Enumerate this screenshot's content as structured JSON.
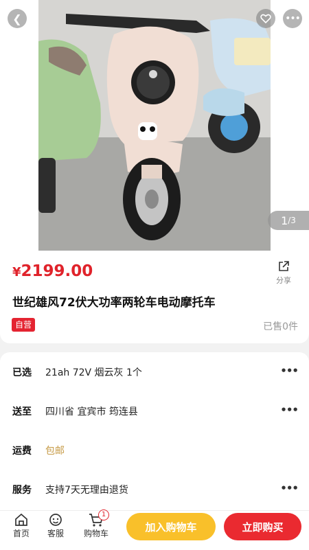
{
  "gallery": {
    "current": "1",
    "total": "/3"
  },
  "product": {
    "currency": "¥",
    "price": "2199.00",
    "title": "世纪雄风72伏大功率两轮车电动摩托车",
    "badge": "自营",
    "sold": "已售0件",
    "share_label": "分享"
  },
  "options": [
    {
      "label": "已选",
      "value": "21ah 72V 烟云灰 1个"
    },
    {
      "label": "送至",
      "value": "四川省 宜宾市 筠连县"
    },
    {
      "label": "运费",
      "value": "包邮"
    },
    {
      "label": "服务",
      "value": "支持7天无理由退货"
    }
  ],
  "bottom_bar": {
    "home": "首页",
    "service": "客服",
    "cart": "购物车",
    "cart_count": "1",
    "add_to_cart": "加入购物车",
    "buy_now": "立即购买"
  },
  "colors": {
    "price": "#e0232b",
    "add_button": "#f9c02a",
    "buy_button": "#ea2a30",
    "shipping": "#c69a45"
  }
}
